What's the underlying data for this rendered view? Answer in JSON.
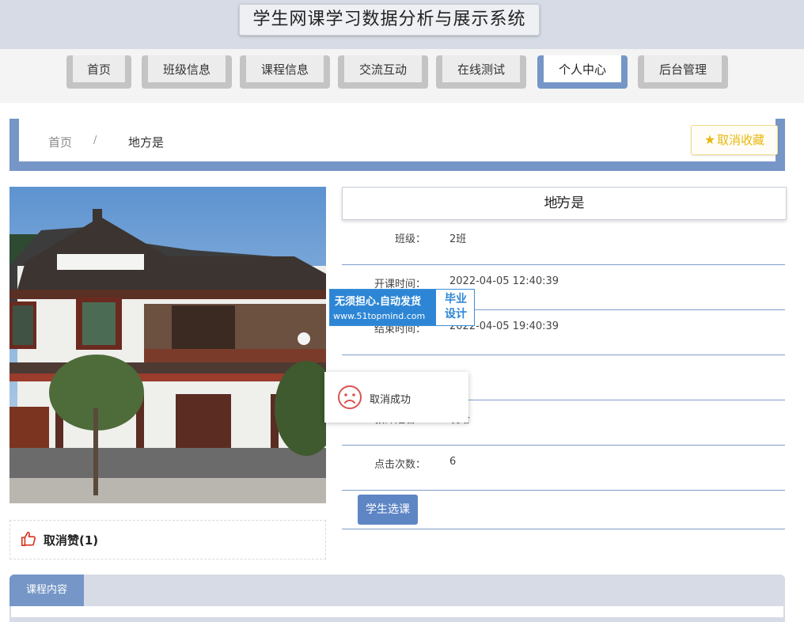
{
  "header": {
    "title": "学生网课学习数据分析与展示系统"
  },
  "nav": {
    "items": [
      {
        "label": "首页"
      },
      {
        "label": "班级信息"
      },
      {
        "label": "课程信息"
      },
      {
        "label": "交流互动"
      },
      {
        "label": "在线测试"
      },
      {
        "label": "个人中心"
      },
      {
        "label": "后台管理"
      }
    ],
    "active_label": "个人中心",
    "active_color": "#7596c7"
  },
  "breadcrumb": {
    "home": "首页",
    "separator": "/",
    "current": "地方是"
  },
  "favorite_button": {
    "label": "取消收藏",
    "icon": "star-icon",
    "color": "#e7b80f"
  },
  "like": {
    "label": "取消赞(1)",
    "icon": "thumbs-up-icon"
  },
  "detail": {
    "title": "地方是",
    "rows": [
      {
        "label": "班级：",
        "value": "2班"
      },
      {
        "label": "开课时间：",
        "value": "2022-04-05 12:40:39"
      },
      {
        "label": "结束时间：",
        "value": "2022-04-05 19:40:39"
      },
      {
        "label": "",
        "value": ""
      },
      {
        "label": "教师姓名：",
        "value": "发给"
      },
      {
        "label": "点击次数：",
        "value": "6"
      }
    ],
    "select_button": "学生选课"
  },
  "watermark": {
    "line1": "无须担心.自动发货",
    "line2": "www.51topmind.com",
    "badge": "毕业设计"
  },
  "toast": {
    "message": "取消成功",
    "icon": "sad-face-icon"
  },
  "content_tab": {
    "label": "课程内容"
  }
}
